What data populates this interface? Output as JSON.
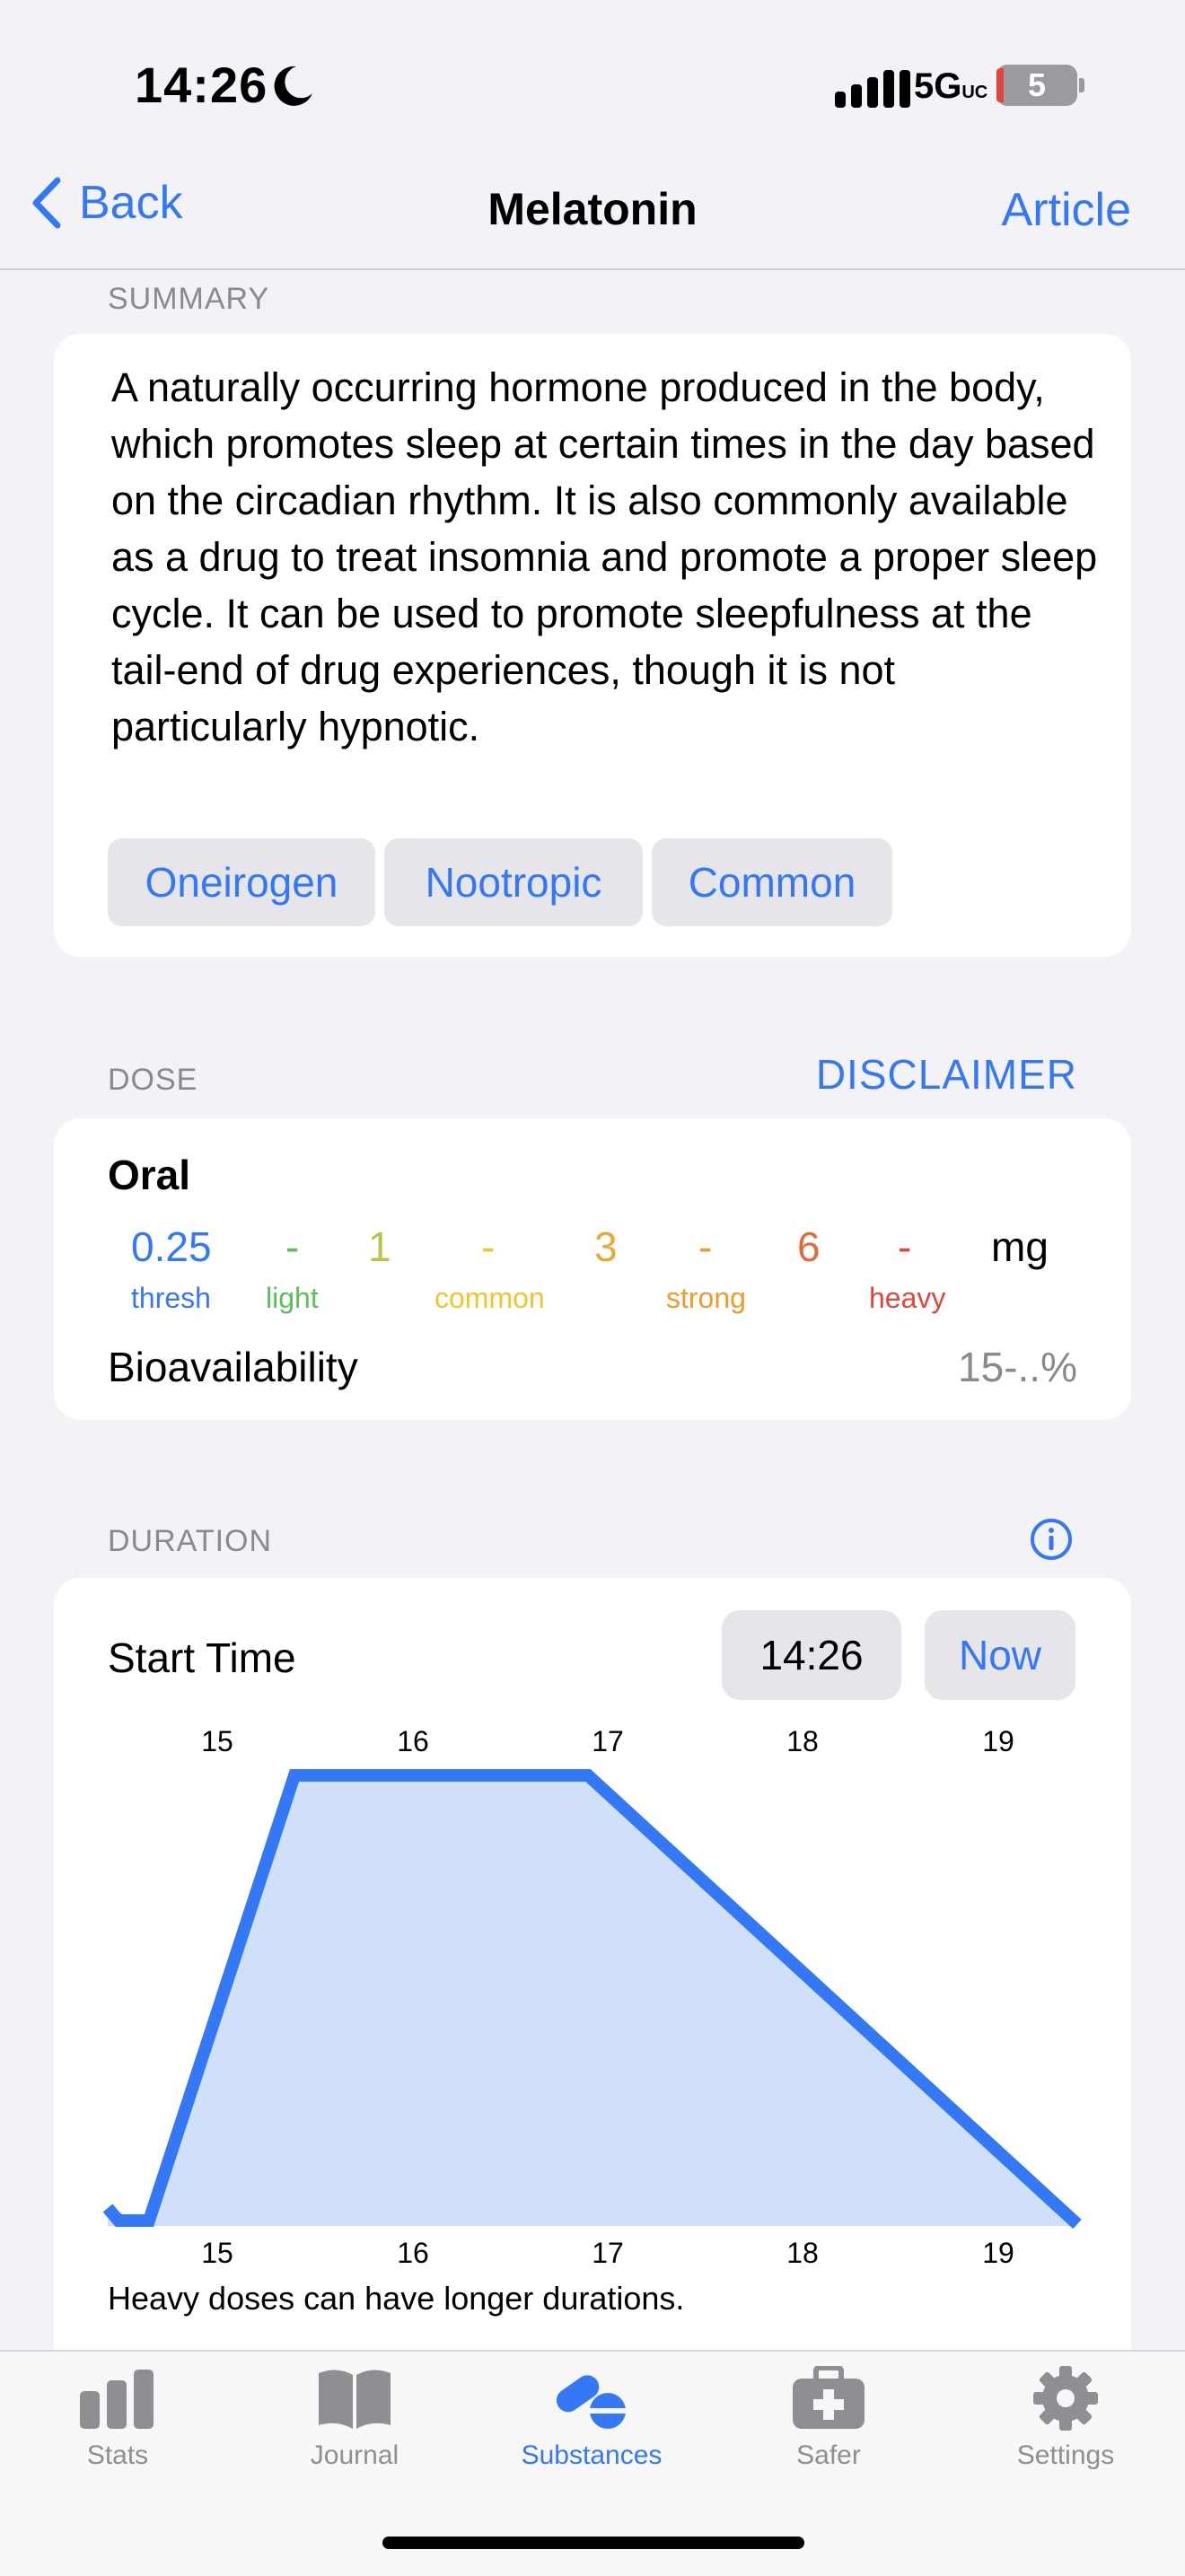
{
  "status_bar": {
    "time": "14:26",
    "network": "5G",
    "network_suffix": "UC",
    "battery": "5"
  },
  "nav": {
    "back_label": "Back",
    "title": "Melatonin",
    "article_label": "Article"
  },
  "summary": {
    "header": "SUMMARY",
    "text": "A naturally occurring hormone produced in the body, which promotes sleep at certain times in the day based on the circadian rhythm. It is also commonly available as a drug to treat insomnia and promote a proper sleep cycle. It can be used to promote sleepfulness at the tail-end of drug experiences, though it is not particularly hypnotic.",
    "tags": [
      "Oneirogen",
      "Nootropic",
      "Common"
    ]
  },
  "dose": {
    "header": "DOSE",
    "disclaimer_label": "DISCLAIMER",
    "route": "Oral",
    "values": [
      "0.25",
      "-",
      "1",
      "-",
      "3",
      "-",
      "6",
      "-",
      "mg"
    ],
    "labels": [
      "thresh",
      "light",
      "common",
      "strong",
      "heavy"
    ],
    "bioavailability_label": "Bioavailability",
    "bioavailability_value": "15-..%"
  },
  "duration": {
    "header": "DURATION",
    "start_time_label": "Start Time",
    "start_time_value": "14:26",
    "now_label": "Now",
    "hour_ticks": [
      "15",
      "16",
      "17",
      "18",
      "19"
    ],
    "note": "Heavy doses can have longer durations."
  },
  "tabs": [
    {
      "label": "Stats",
      "icon": "chart-bars-icon",
      "active": false
    },
    {
      "label": "Journal",
      "icon": "book-icon",
      "active": false
    },
    {
      "label": "Substances",
      "icon": "pills-icon",
      "active": true
    },
    {
      "label": "Safer",
      "icon": "first-aid-kit-icon",
      "active": false
    },
    {
      "label": "Settings",
      "icon": "gear-icon",
      "active": false
    }
  ],
  "colors": {
    "accent": "#3478f6",
    "thresh": "#3478f6",
    "light": "#5bbf5a",
    "common": "#f1c62c",
    "strong": "#ef9a2c",
    "heavy": "#e0473c",
    "common_value": "#b9c34a"
  }
}
